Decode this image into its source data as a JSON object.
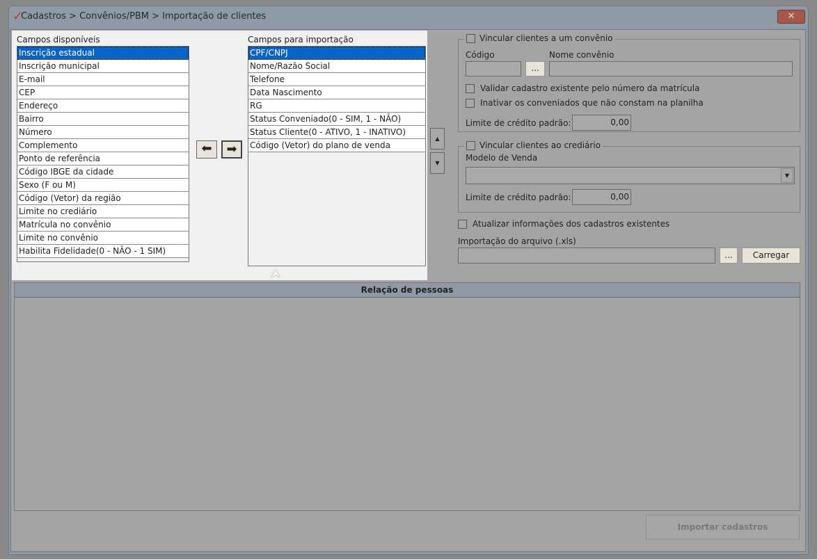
{
  "window": {
    "title": "Cadastros > Convênios/PBM > Importação de clientes",
    "close_label": "✕"
  },
  "available": {
    "label": "Campos disponíveis",
    "items": [
      "Inscrição estadual",
      "Inscrição municipal",
      "E-mail",
      "CEP",
      "Endereço",
      "Bairro",
      "Número",
      "Complemento",
      "Ponto de referência",
      "Código IBGE da cidade",
      "Sexo (F ou M)",
      "Código (Vetor) da região",
      "Limite no crediário",
      "Matrícula no convênio",
      "Limite no convênio",
      "Habilita Fidelidade(0 - NÃO - 1 SIM)"
    ]
  },
  "import": {
    "label": "Campos para importação",
    "items": [
      "CPF/CNPJ",
      "Nome/Razão Social",
      "Telefone",
      "Data Nascimento",
      "RG",
      "Status Conveniado(0 - SIM, 1 - NÃO)",
      "Status Cliente(0 - ATIVO, 1 - INATIVO)",
      "Código (Vetor) do plano de venda"
    ]
  },
  "convenio": {
    "title": "Vincular clientes a um convênio",
    "codigo_label": "Código",
    "codigo_value": "",
    "browse": "...",
    "nome_label": "Nome convênio",
    "nome_value": "",
    "validar": "Validar cadastro existente pelo número da matrícula",
    "inativar": "Inativar os conveniados que não constam na planilha",
    "limite_label": "Limite de crédito padrão:",
    "limite_value": "0,00"
  },
  "crediario": {
    "title": "Vincular clientes ao crediário",
    "modelo_label": "Modelo de Venda",
    "modelo_value": "",
    "limite_label": "Limite de crédito padrão:",
    "limite_value": "0,00"
  },
  "atualizar": "Atualizar informações dos cadastros existentes",
  "arquivo": {
    "label": "Importação do arquivo (.xls)",
    "value": "",
    "browse": "...",
    "load": "Carregar"
  },
  "relacao": {
    "title": "Relação de pessoas"
  },
  "importar": "Importar cadastros"
}
